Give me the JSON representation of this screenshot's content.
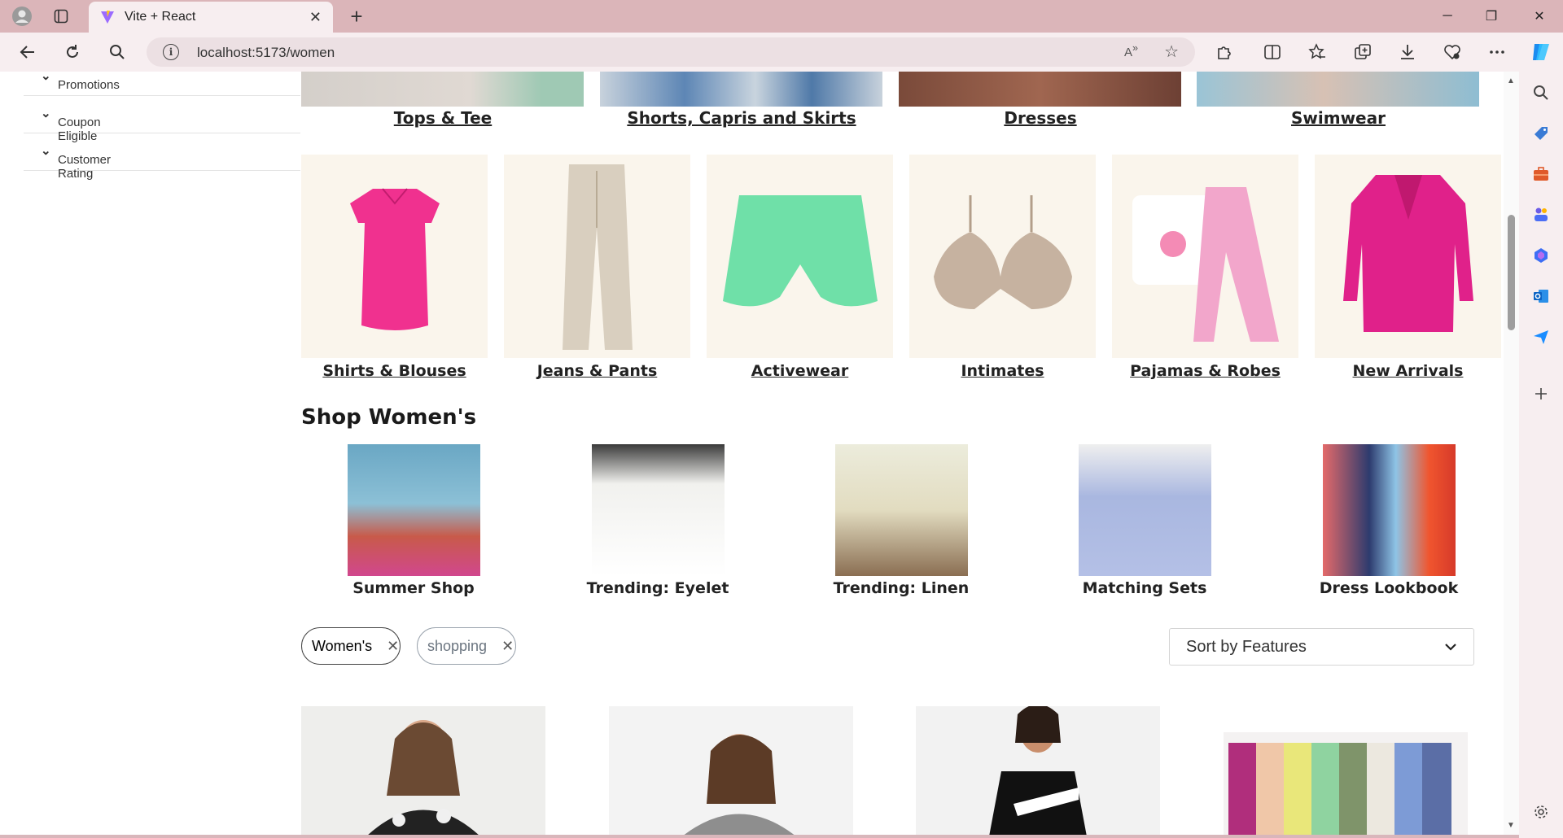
{
  "browser": {
    "tab_title": "Vite + React",
    "url": "localhost:5173/women"
  },
  "filters": [
    {
      "label": "Promotions"
    },
    {
      "label": "Coupon Eligible"
    },
    {
      "label": "Customer Rating"
    }
  ],
  "top_categories": [
    {
      "label": "Tops & Tee"
    },
    {
      "label": "Shorts, Capris and Skirts"
    },
    {
      "label": "Dresses"
    },
    {
      "label": "Swimwear"
    }
  ],
  "categories": [
    {
      "label": "Shirts & Blouses"
    },
    {
      "label": "Jeans & Pants"
    },
    {
      "label": "Activewear"
    },
    {
      "label": "Intimates"
    },
    {
      "label": "Pajamas & Robes"
    },
    {
      "label": "New Arrivals"
    }
  ],
  "shop_heading": "Shop Women's",
  "shop_items": [
    {
      "label": "Summer Shop"
    },
    {
      "label": "Trending: Eyelet"
    },
    {
      "label": "Trending: Linen"
    },
    {
      "label": "Matching Sets"
    },
    {
      "label": "Dress Lookbook"
    }
  ],
  "active_filters": [
    {
      "label": "Women's"
    },
    {
      "label": "shopping"
    }
  ],
  "sort": {
    "label": "Sort by Features"
  },
  "colors": {
    "accent_pink": "#f0318f",
    "mint": "#6fe0a8",
    "tile_bg": "#faf5ec"
  }
}
